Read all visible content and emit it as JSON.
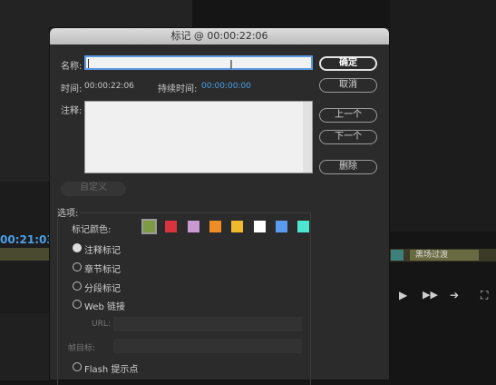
{
  "background": {
    "timecode": "00:21:03",
    "clip_label": "黑场过渡",
    "playback": {
      "play": "▶",
      "step_forward": "▶▶",
      "insert": "➔",
      "overwrite": "⛶"
    }
  },
  "dialog": {
    "title": "标记 @ 00:00:22:06",
    "name_label": "名称:",
    "name_value": "",
    "time_label": "时间:",
    "time_value": "00:00:22:06",
    "duration_label": "持续时间:",
    "duration_value": "00:00:00:00",
    "comment_label": "注释:",
    "comment_value": "",
    "custom_button": "自定义",
    "buttons": {
      "ok": "确定",
      "cancel": "取消",
      "prev": "上一个",
      "next": "下一个",
      "delete": "删除"
    },
    "options": {
      "legend": "选项:",
      "color_label": "标记颜色:",
      "colors": [
        "#7e9b43",
        "#d8343f",
        "#c79ad2",
        "#f08c26",
        "#f0b82c",
        "#ffffff",
        "#5a9bef",
        "#4ee6d0"
      ],
      "selected_color": 0,
      "types": [
        {
          "label": "注释标记",
          "selected": true
        },
        {
          "label": "章节标记",
          "selected": false
        },
        {
          "label": "分段标记",
          "selected": false
        },
        {
          "label": "Web 链接",
          "selected": false
        }
      ],
      "url_label": "URL:",
      "frame_target_label": "帧目标:",
      "flash_label": "Flash 提示点"
    }
  }
}
